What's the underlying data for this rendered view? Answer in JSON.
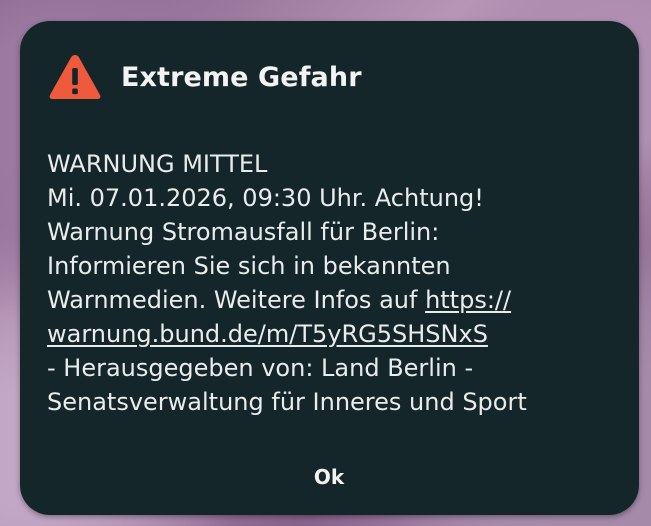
{
  "dialog": {
    "title": "Extreme Gefahr",
    "icon": "warning-triangle-icon",
    "accent_color": "#f05a3c",
    "background_color": "#15262a",
    "message": {
      "line1": "WARNUNG MITTEL",
      "line2": "Mi. 07.01.2026, 09:30 Uhr. Achtung!",
      "line3": "Warnung Stromausfall für Berlin:",
      "line4": "Informieren Sie sich in bekannten",
      "line5_text": "Warnmedien. Weitere Infos auf ",
      "link_part1": "https://",
      "link_part2": "warnung.bund.de/m/T5yRG5SHSNxS",
      "line7": "- Herausgegeben von: Land Berlin -",
      "line8": "Senatsverwaltung für Inneres und Sport"
    },
    "ok_label": "Ok"
  }
}
